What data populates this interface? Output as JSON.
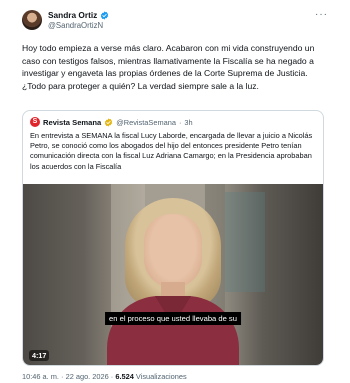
{
  "author": {
    "name": "Sandra Ortiz",
    "handle": "@SandraOrtizN",
    "verified_color": "#1d9bf0"
  },
  "tweet": {
    "text": "Hoy todo empieza a verse más claro. Acabaron con mi vida construyendo un caso con testigos falsos, mientras llamativamente la Fiscalía se ha negado a investigar y engaveta las propias órdenes de la Corte Suprema de Justicia. ¿Todo para proteger a quién? La verdad siempre sale a la luz."
  },
  "quote": {
    "logo_letter": "S",
    "logo_color": "#e0242b",
    "name": "Revista Semana",
    "handle": "@RevistaSemana",
    "separator": "·",
    "time": "3h",
    "text": "En entrevista a SEMANA la fiscal Lucy Laborde, encargada de llevar a juicio a Nicolás Petro, se conoció como los abogados del hijo del entonces presidente Petro tenían comunicación directa con la fiscal Luz Adriana Camargo; en la Presidencia aprobaban los acuerdos con la Fiscalía",
    "video": {
      "caption": "en el proceso que usted llevaba de su",
      "duration": "4:17"
    }
  },
  "footer": {
    "time": "10:46 a. m.",
    "sep1": "·",
    "date": "22 ago. 2026",
    "sep2": "·",
    "views_count": "6.524",
    "views_label": "Visualizaciones"
  }
}
